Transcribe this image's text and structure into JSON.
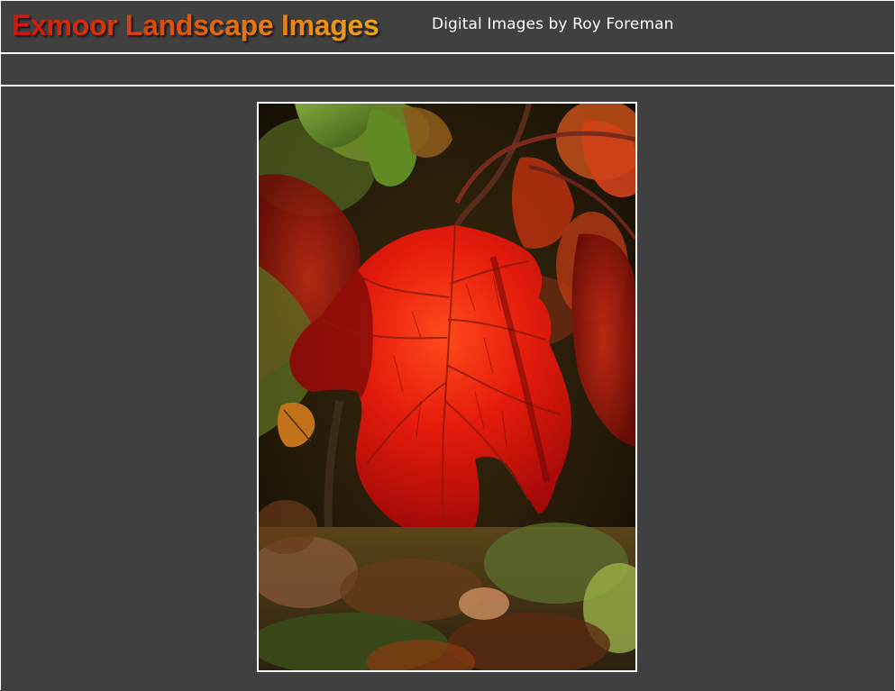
{
  "header": {
    "site_title": "Exmoor Landscape Images",
    "subtitle": "Digital Images by Roy Foreman"
  },
  "colors": {
    "background": "#404040",
    "rule": "#ffffff",
    "title_gradient_start": "#d0140c",
    "title_gradient_end": "#f0a317",
    "subtitle_text": "#ffffff"
  },
  "photo": {
    "subject_icon": "red-autumn-leaf-photo"
  }
}
